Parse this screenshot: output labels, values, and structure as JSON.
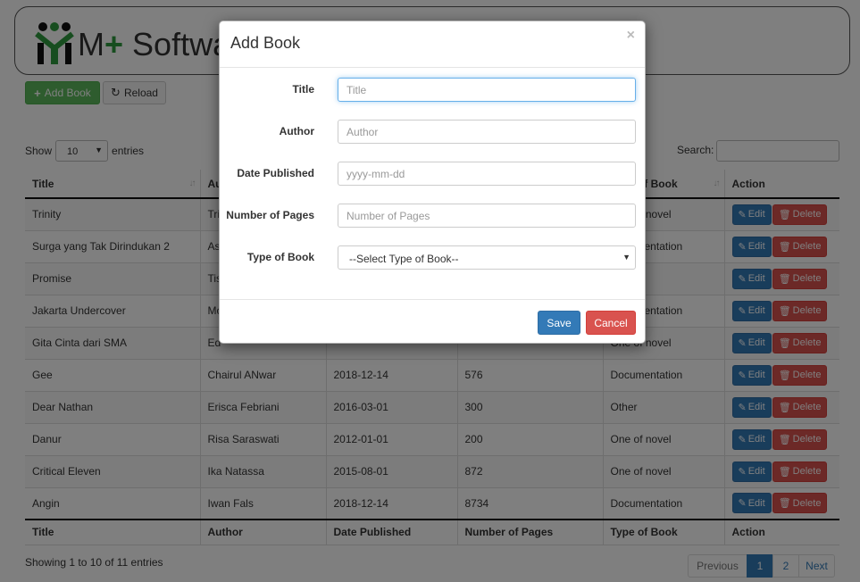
{
  "header": {
    "brand_prefix": "M",
    "brand_plus": "+",
    "brand_suffix": " Software"
  },
  "toolbar": {
    "add_label": "Add Book",
    "reload_label": "Reload"
  },
  "length": {
    "show_label": "Show",
    "value": "10",
    "entries_label": "entries"
  },
  "search": {
    "label": "Search:"
  },
  "table": {
    "headers": [
      "Title",
      "Author",
      "Date Published",
      "Number of Pages",
      "Type of Book",
      "Action"
    ],
    "rows": [
      [
        "Trinity",
        "Tri",
        "",
        "",
        "One of novel"
      ],
      [
        "Surga yang Tak Dirindukan 2",
        "As",
        "",
        "",
        "Documentation"
      ],
      [
        "Promise",
        "Tis",
        "",
        "",
        ""
      ],
      [
        "Jakarta Undercover",
        "Mo",
        "",
        "",
        "Documentation"
      ],
      [
        "Gita Cinta dari SMA",
        "Ed",
        "",
        "",
        "One of novel"
      ],
      [
        "Gee",
        "Chairul ANwar",
        "2018-12-14",
        "576",
        "Documentation"
      ],
      [
        "Dear Nathan",
        "Erisca Febriani",
        "2016-03-01",
        "300",
        "Other"
      ],
      [
        "Danur",
        "Risa Saraswati",
        "2012-01-01",
        "200",
        "One of novel"
      ],
      [
        "Critical Eleven",
        "Ika Natassa",
        "2015-08-01",
        "872",
        "One of novel"
      ],
      [
        "Angin",
        "Iwan Fals",
        "2018-12-14",
        "8734",
        "Documentation"
      ]
    ],
    "edit_label": "Edit",
    "delete_label": "Delete"
  },
  "footer": {
    "info": "Showing 1 to 10 of 11 entries",
    "previous": "Previous",
    "pages": [
      "1",
      "2"
    ],
    "next": "Next"
  },
  "modal": {
    "title": "Add Book",
    "close": "×",
    "fields": [
      {
        "label": "Title",
        "placeholder": "Title"
      },
      {
        "label": "Author",
        "placeholder": "Author"
      },
      {
        "label": "Date Published",
        "placeholder": "yyyy-mm-dd"
      },
      {
        "label": "Number of Pages",
        "placeholder": "Number of Pages"
      }
    ],
    "type_label": "Type of Book",
    "type_value": "--Select Type of Book--",
    "save_label": "Save",
    "cancel_label": "Cancel"
  },
  "colors": {
    "primary": "#337ab7",
    "success": "#5cb85c",
    "danger": "#d9534f",
    "brand_green": "#2e9b3e"
  }
}
